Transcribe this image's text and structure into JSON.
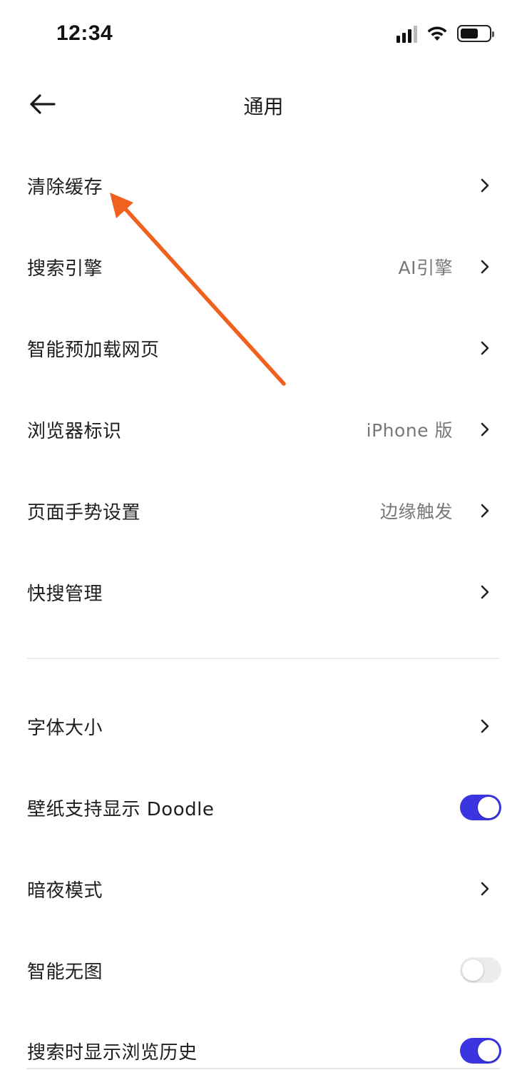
{
  "status_bar": {
    "time": "12:34",
    "icons": [
      "signal-icon",
      "wifi-icon",
      "battery-icon"
    ]
  },
  "header": {
    "back_icon": "arrow-left-icon",
    "title": "通用"
  },
  "settings": [
    {
      "label": "清除缓存",
      "value": "",
      "control": "chevron"
    },
    {
      "label": "搜索引擎",
      "value": "AI引擎",
      "control": "chevron"
    },
    {
      "label": "智能预加载网页",
      "value": "",
      "control": "chevron"
    },
    {
      "label": "浏览器标识",
      "value": "iPhone 版",
      "control": "chevron"
    },
    {
      "label": "页面手势设置",
      "value": "边缘触发",
      "control": "chevron"
    },
    {
      "label": "快搜管理",
      "value": "",
      "control": "chevron"
    }
  ],
  "settings2": [
    {
      "label": "字体大小",
      "control": "chevron"
    },
    {
      "label": "壁纸支持显示 Doodle",
      "control": "toggle",
      "on": true
    },
    {
      "label": "暗夜模式",
      "control": "chevron"
    },
    {
      "label": "智能无图",
      "control": "toggle",
      "on": false
    },
    {
      "label": "搜索时显示浏览历史",
      "control": "toggle",
      "on": true
    }
  ],
  "colors": {
    "toggle_on": "#3a35e0",
    "toggle_off": "#ececec",
    "annotation_arrow": "#f0601e"
  }
}
